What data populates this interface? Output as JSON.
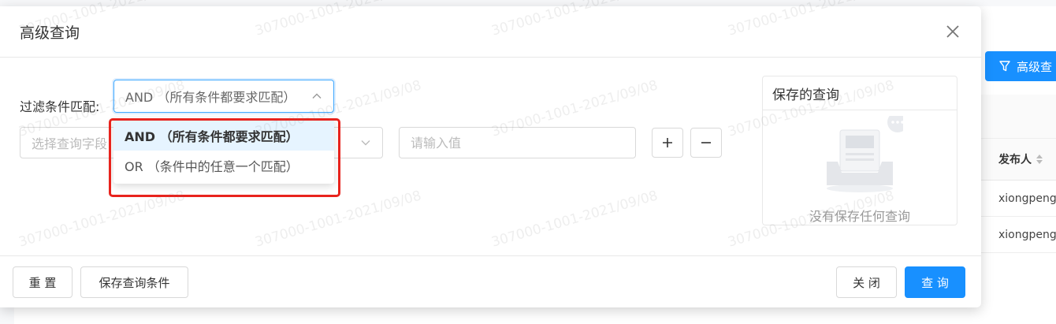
{
  "background": {
    "advanced_button_label": "高级查",
    "table_header": "发布人",
    "rows": [
      "xiongpeng",
      "xiongpeng"
    ]
  },
  "modal": {
    "title": "高级查询",
    "match_label": "过滤条件匹配:",
    "match_selected": "AND （所有条件都要求匹配）",
    "match_options": [
      "AND （所有条件都要求匹配）",
      "OR （条件中的任意一个匹配）"
    ],
    "field_placeholder": "选择查询字段",
    "value_placeholder": "请输入值",
    "saved_title": "保存的查询",
    "saved_empty": "没有保存任何查询",
    "buttons": {
      "reset": "重 置",
      "save_query": "保存查询条件",
      "close": "关 闭",
      "query": "查 询"
    }
  },
  "watermark": "307000-1001-2021/09/08",
  "colors": {
    "primary": "#1890ff",
    "highlight_box": "#e8231d",
    "selected_option_bg": "#e6f4ff"
  }
}
